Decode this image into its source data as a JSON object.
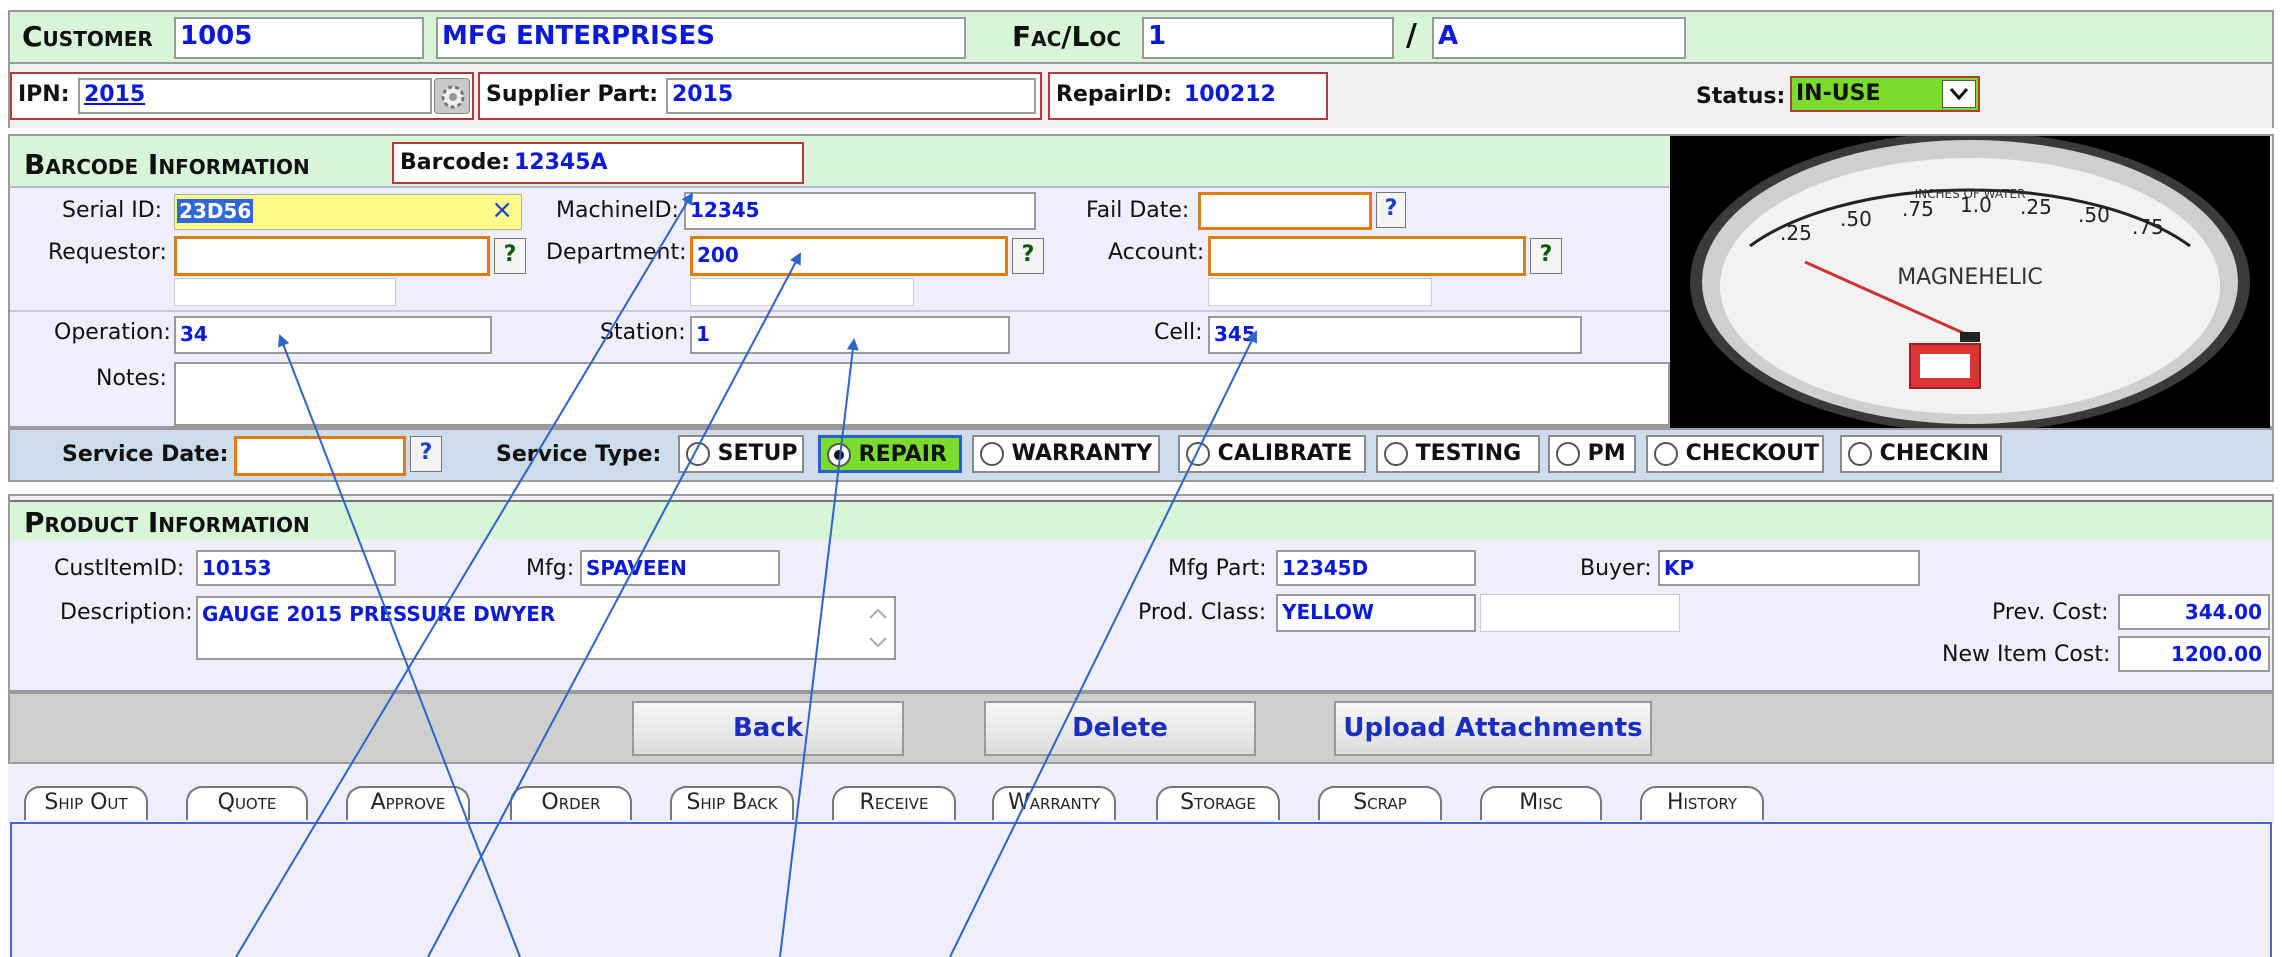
{
  "header": {
    "customer_label": "Customer",
    "customer_id": "1005",
    "customer_name": "MFG ENTERPRISES",
    "facloc_label": "Fac/Loc",
    "fac": "1",
    "slash": "/",
    "loc": "A"
  },
  "row2": {
    "ipn_label": "IPN:",
    "ipn_value": "2015",
    "supplier_part_label": "Supplier Part:",
    "supplier_part_value": "2015",
    "repair_id_label": "RepairID:",
    "repair_id_value": "100212",
    "status_label": "Status:",
    "status_value": "IN-USE",
    "status_color": "#7cdc2c"
  },
  "barcode": {
    "section_title": "Barcode Information",
    "barcode_label": "Barcode:",
    "barcode_value": "12345A",
    "serial_label": "Serial ID:",
    "serial_value": "23D56",
    "clear_icon": "×",
    "machine_label": "MachineID:",
    "machine_value": "12345",
    "fail_label": "Fail Date:",
    "fail_value": "",
    "requestor_label": "Requestor:",
    "requestor_value": "",
    "department_label": "Department:",
    "department_value": "200",
    "account_label": "Account:",
    "account_value": "",
    "operation_label": "Operation:",
    "operation_value": "34",
    "station_label": "Station:",
    "station_value": "1",
    "cell_label": "Cell:",
    "cell_value": "345",
    "notes_label": "Notes:",
    "notes_value": "",
    "lookup": "?"
  },
  "service": {
    "date_label": "Service Date:",
    "date_value": "",
    "type_label": "Service Type:",
    "types": [
      "SETUP",
      "REPAIR",
      "WARRANTY",
      "CALIBRATE",
      "TESTING",
      "PM",
      "CHECKOUT",
      "CHECKIN"
    ],
    "selected": "REPAIR"
  },
  "product": {
    "section_title": "Product Information",
    "custitem_label": "CustItemID:",
    "custitem_value": "10153",
    "mfg_label": "Mfg:",
    "mfg_value": "SPAVEEN",
    "mfgpart_label": "Mfg Part:",
    "mfgpart_value": "12345D",
    "buyer_label": "Buyer:",
    "buyer_value": "KP",
    "description_label": "Description:",
    "description_value": "GAUGE 2015 PRESSURE DWYER",
    "prodclass_label": "Prod. Class:",
    "prodclass_value": "YELLOW",
    "prev_cost_label": "Prev. Cost:",
    "prev_cost_value": "344.00",
    "new_cost_label": "New Item Cost:",
    "new_cost_value": "1200.00"
  },
  "gauge": {
    "top_text": "INCHES OF WATER",
    "scale": [
      ".25",
      ".50",
      ".75",
      "1.0",
      ".25",
      ".50",
      ".75"
    ],
    "brand": "MAGNEHELIC"
  },
  "actions": {
    "back": "Back",
    "delete": "Delete",
    "upload": "Upload Attachments"
  },
  "tabs": [
    "Ship Out",
    "Quote",
    "Approve",
    "Order",
    "Ship Back",
    "Receive",
    "Warranty",
    "Storage",
    "Scrap",
    "Misc",
    "History"
  ],
  "colors": {
    "header_bg": "#d8f5d8",
    "form_bg": "#eeeefc",
    "service_bg": "#cddceb",
    "value_text": "#0a1ad8",
    "arrow": "#2d64c8"
  }
}
